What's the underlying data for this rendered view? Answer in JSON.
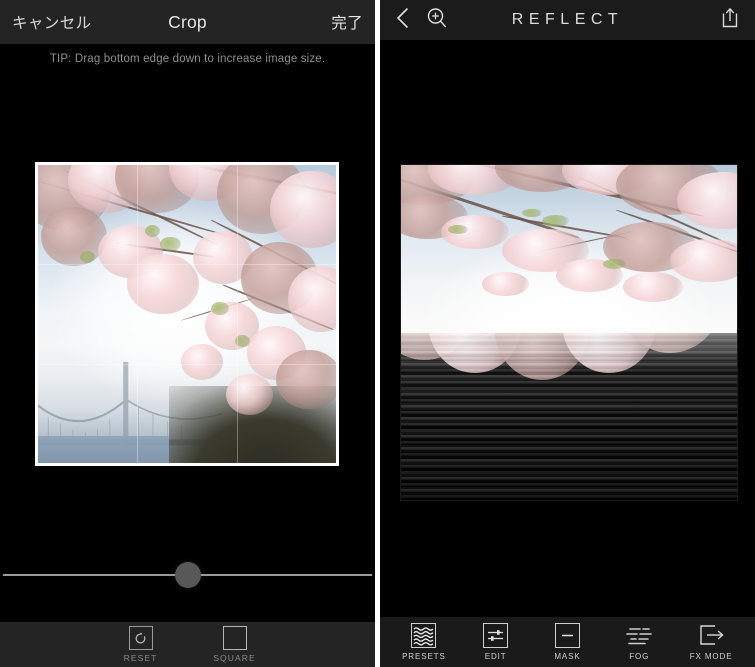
{
  "left_panel": {
    "navbar": {
      "cancel_label": "キャンセル",
      "title": "Crop",
      "done_label": "完了"
    },
    "tip_text": "TIP: Drag bottom edge down to increase image size.",
    "slider": {
      "value_percent": 50
    },
    "toolbar": [
      {
        "label": "RESET",
        "icon": "reset-icon"
      },
      {
        "label": "SQUARE",
        "icon": "square-icon"
      }
    ],
    "photo": {
      "subject": "cherry blossoms over suspension bridge",
      "crop_shape": "square"
    }
  },
  "right_panel": {
    "navbar": {
      "title": "REFLECT",
      "back_icon": "chevron-left-icon",
      "zoom_icon": "magnifier-plus-icon",
      "share_icon": "share-up-icon"
    },
    "photo": {
      "subject": "cherry blossoms mirrored in rippled water"
    },
    "toolbar": [
      {
        "label": "PRESETS",
        "icon": "waves-icon"
      },
      {
        "label": "EDIT",
        "icon": "sliders-icon"
      },
      {
        "label": "MASK",
        "icon": "minus-box-icon"
      },
      {
        "label": "FOG",
        "icon": "fog-lines-icon"
      },
      {
        "label": "FX MODE",
        "icon": "arrow-out-box-icon"
      }
    ]
  },
  "colors": {
    "background": "#000000",
    "navbar_left": "#242424",
    "navbar_right": "#1b1b1b",
    "toolbar_right": "#1a1a1a",
    "text_primary": "#e4e4e4",
    "text_dim": "#8a8a8a",
    "divider": "#ffffff",
    "crop_frame": "#ffffff",
    "slider_thumb": "#585858"
  }
}
